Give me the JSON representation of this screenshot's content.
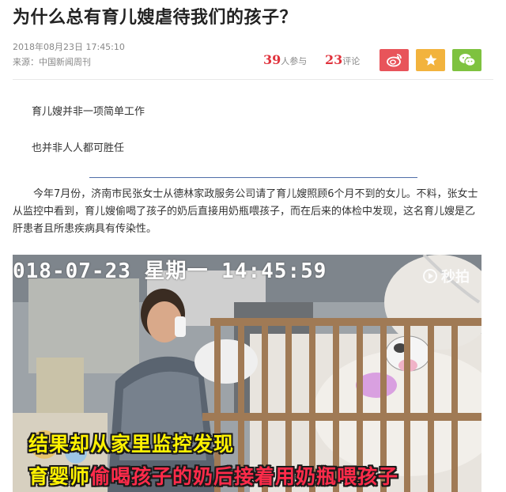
{
  "article": {
    "title": "为什么总有育儿嫂虐待我们的孩子？",
    "date": "2018年08月23日  17:45:10",
    "source": "来源：中国新闻周刊",
    "participants_count": "39",
    "participants_label": "人参与",
    "comments_count": "23",
    "comments_label": "评论",
    "intro_line1": "育儿嫂并非一项简单工作",
    "intro_line2": "也并非人人都可胜任",
    "body_lines": [
      "今年7月份，济南市民张女士从德林家政服务公司请了育儿嫂照顾6个月不到的女儿。不料，张女士",
      "从监控中看到，育儿嫂偷喝了孩子的奶后直接用奶瓶喂孩子，而在后来的体检中发现，这名育儿嫂是乙",
      "肝患者且所患疾病具有传染性。"
    ]
  },
  "share": {
    "icons": [
      "weibo-icon",
      "star-icon",
      "wechat-icon"
    ],
    "colors": {
      "weibo": "#e8545a",
      "favorite": "#f2b33d",
      "wechat": "#7ec23f"
    }
  },
  "photo": {
    "timestamp_overlay": "018-07-23  星期一  14:45:59",
    "watermark": "秒拍",
    "caption_line1": "结果却从家里监控发现",
    "caption_line2_prefix": "育婴师",
    "caption_line2_highlight": "偷喝孩子的奶后接着用奶瓶喂孩子"
  },
  "colors": {
    "accent_red": "#e0323c",
    "rule_blue": "#4f6ea8",
    "caption_yellow": "#fff200",
    "caption_red": "#ff2b4a"
  }
}
